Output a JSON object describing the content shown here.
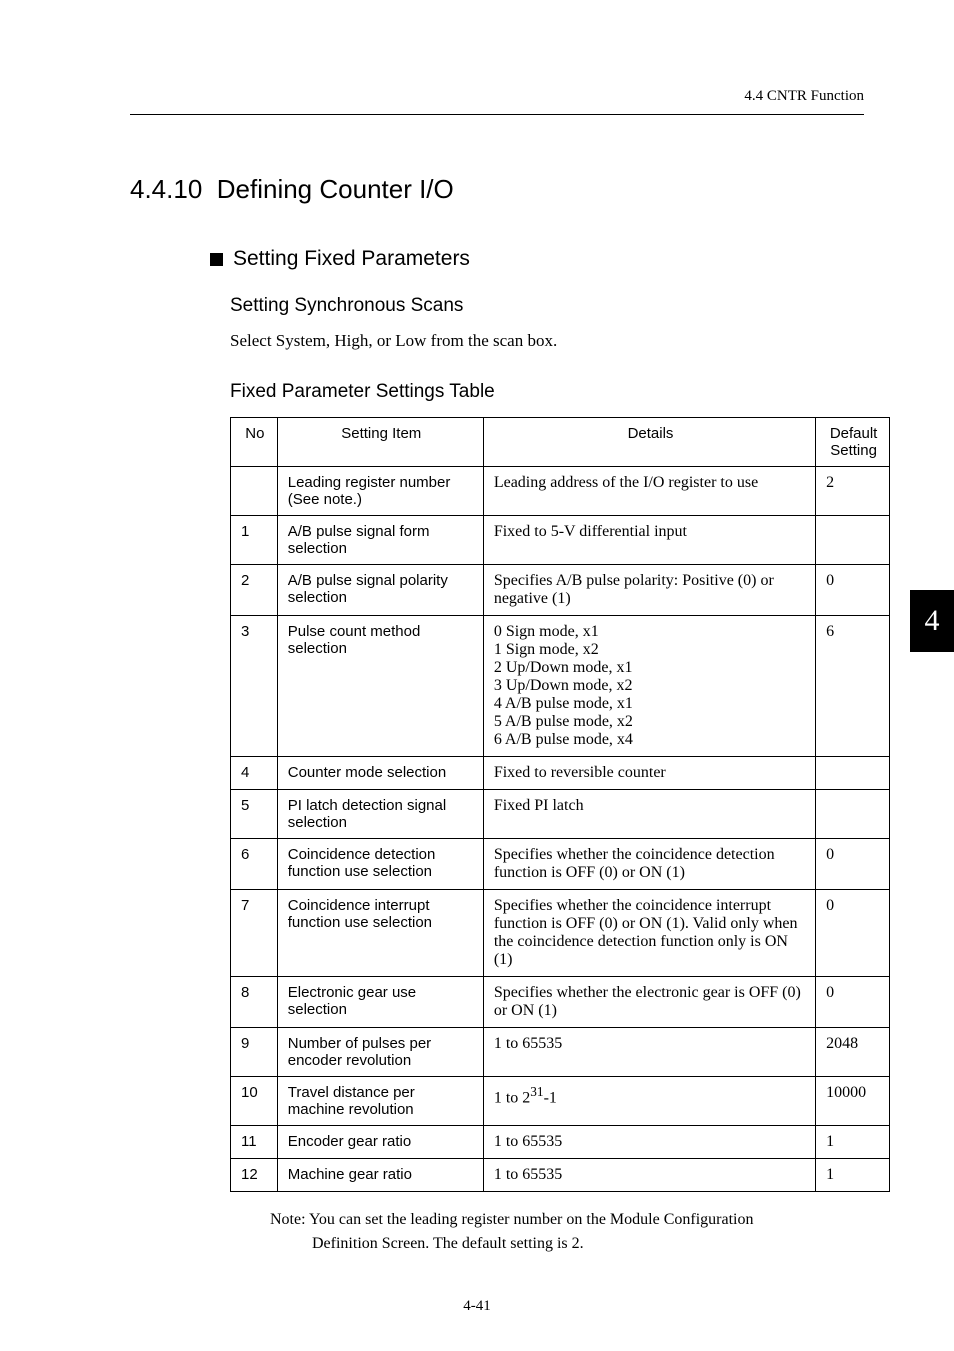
{
  "crumb": "4.4 CNTR Function",
  "section_number": "4.4.10",
  "section_title": "Defining Counter I/O",
  "sub1": "Setting Fixed Parameters",
  "sub2_a": "Setting Synchronous Scans",
  "body_a": "Select System, High, or Low from the scan box.",
  "sub2_b": "Fixed Parameter Settings Table",
  "table": {
    "headers": {
      "no": "No",
      "item": "Setting Item",
      "details": "Details",
      "default_l1": "Default",
      "default_l2": "Setting"
    },
    "rows": [
      {
        "no": "",
        "item": "Leading register number (See note.)",
        "details": "Leading address of the I/O register to use",
        "default": "2"
      },
      {
        "no": "1",
        "item": " A/B pulse signal form selection",
        "details": "Fixed to 5-V differential input",
        "default": ""
      },
      {
        "no": "2",
        "item": "A/B pulse signal polarity selection",
        "details": "Specifies A/B pulse polarity: Positive (0) or negative (1)",
        "default": "0"
      },
      {
        "no": "3",
        "item": "Pulse count method selection",
        "details": "0  Sign mode, x1\n1  Sign mode, x2\n2  Up/Down mode, x1\n3  Up/Down mode, x2\n4  A/B pulse mode, x1\n5  A/B pulse mode, x2\n6  A/B pulse mode, x4",
        "default": "6"
      },
      {
        "no": "4",
        "item": "Counter mode selection",
        "details": " Fixed to reversible counter",
        "default": ""
      },
      {
        "no": "5",
        "item": "PI latch detection signal selection",
        "details": "Fixed PI latch",
        "default": ""
      },
      {
        "no": "6",
        "item": "Coincidence detection function use selection",
        "details": "Specifies whether the coincidence detection function is OFF (0) or ON (1)",
        "default": "0"
      },
      {
        "no": "7",
        "item": "Coincidence interrupt function use selection",
        "details": "Specifies whether the coincidence interrupt function is OFF (0) or ON (1). Valid only when the coincidence detection function only is ON (1)",
        "default": "0"
      },
      {
        "no": "8",
        "item": "Electronic gear use selection",
        "details": "Specifies whether the electronic gear is OFF (0) or ON (1)",
        "default": "0"
      },
      {
        "no": "9",
        "item": "Number of pulses per encoder revolution",
        "details": "1 to 65535",
        "default": "2048"
      },
      {
        "no": "10",
        "item": "Travel distance per machine revolution",
        "details_pre": "1 to 2",
        "details_sup": "31",
        "details_post": "-1",
        "default": "10000"
      },
      {
        "no": "11",
        "item": "Encoder gear ratio",
        "details": "1 to 65535",
        "default": "1"
      },
      {
        "no": "12",
        "item": "Machine gear ratio",
        "details": "1 to 65535",
        "default": "1"
      }
    ]
  },
  "note_l1": "Note: You can set the leading register number on the Module Configuration",
  "note_l2": "Definition Screen. The default setting is 2.",
  "chapter_tab": "4",
  "page_number": "4-41"
}
